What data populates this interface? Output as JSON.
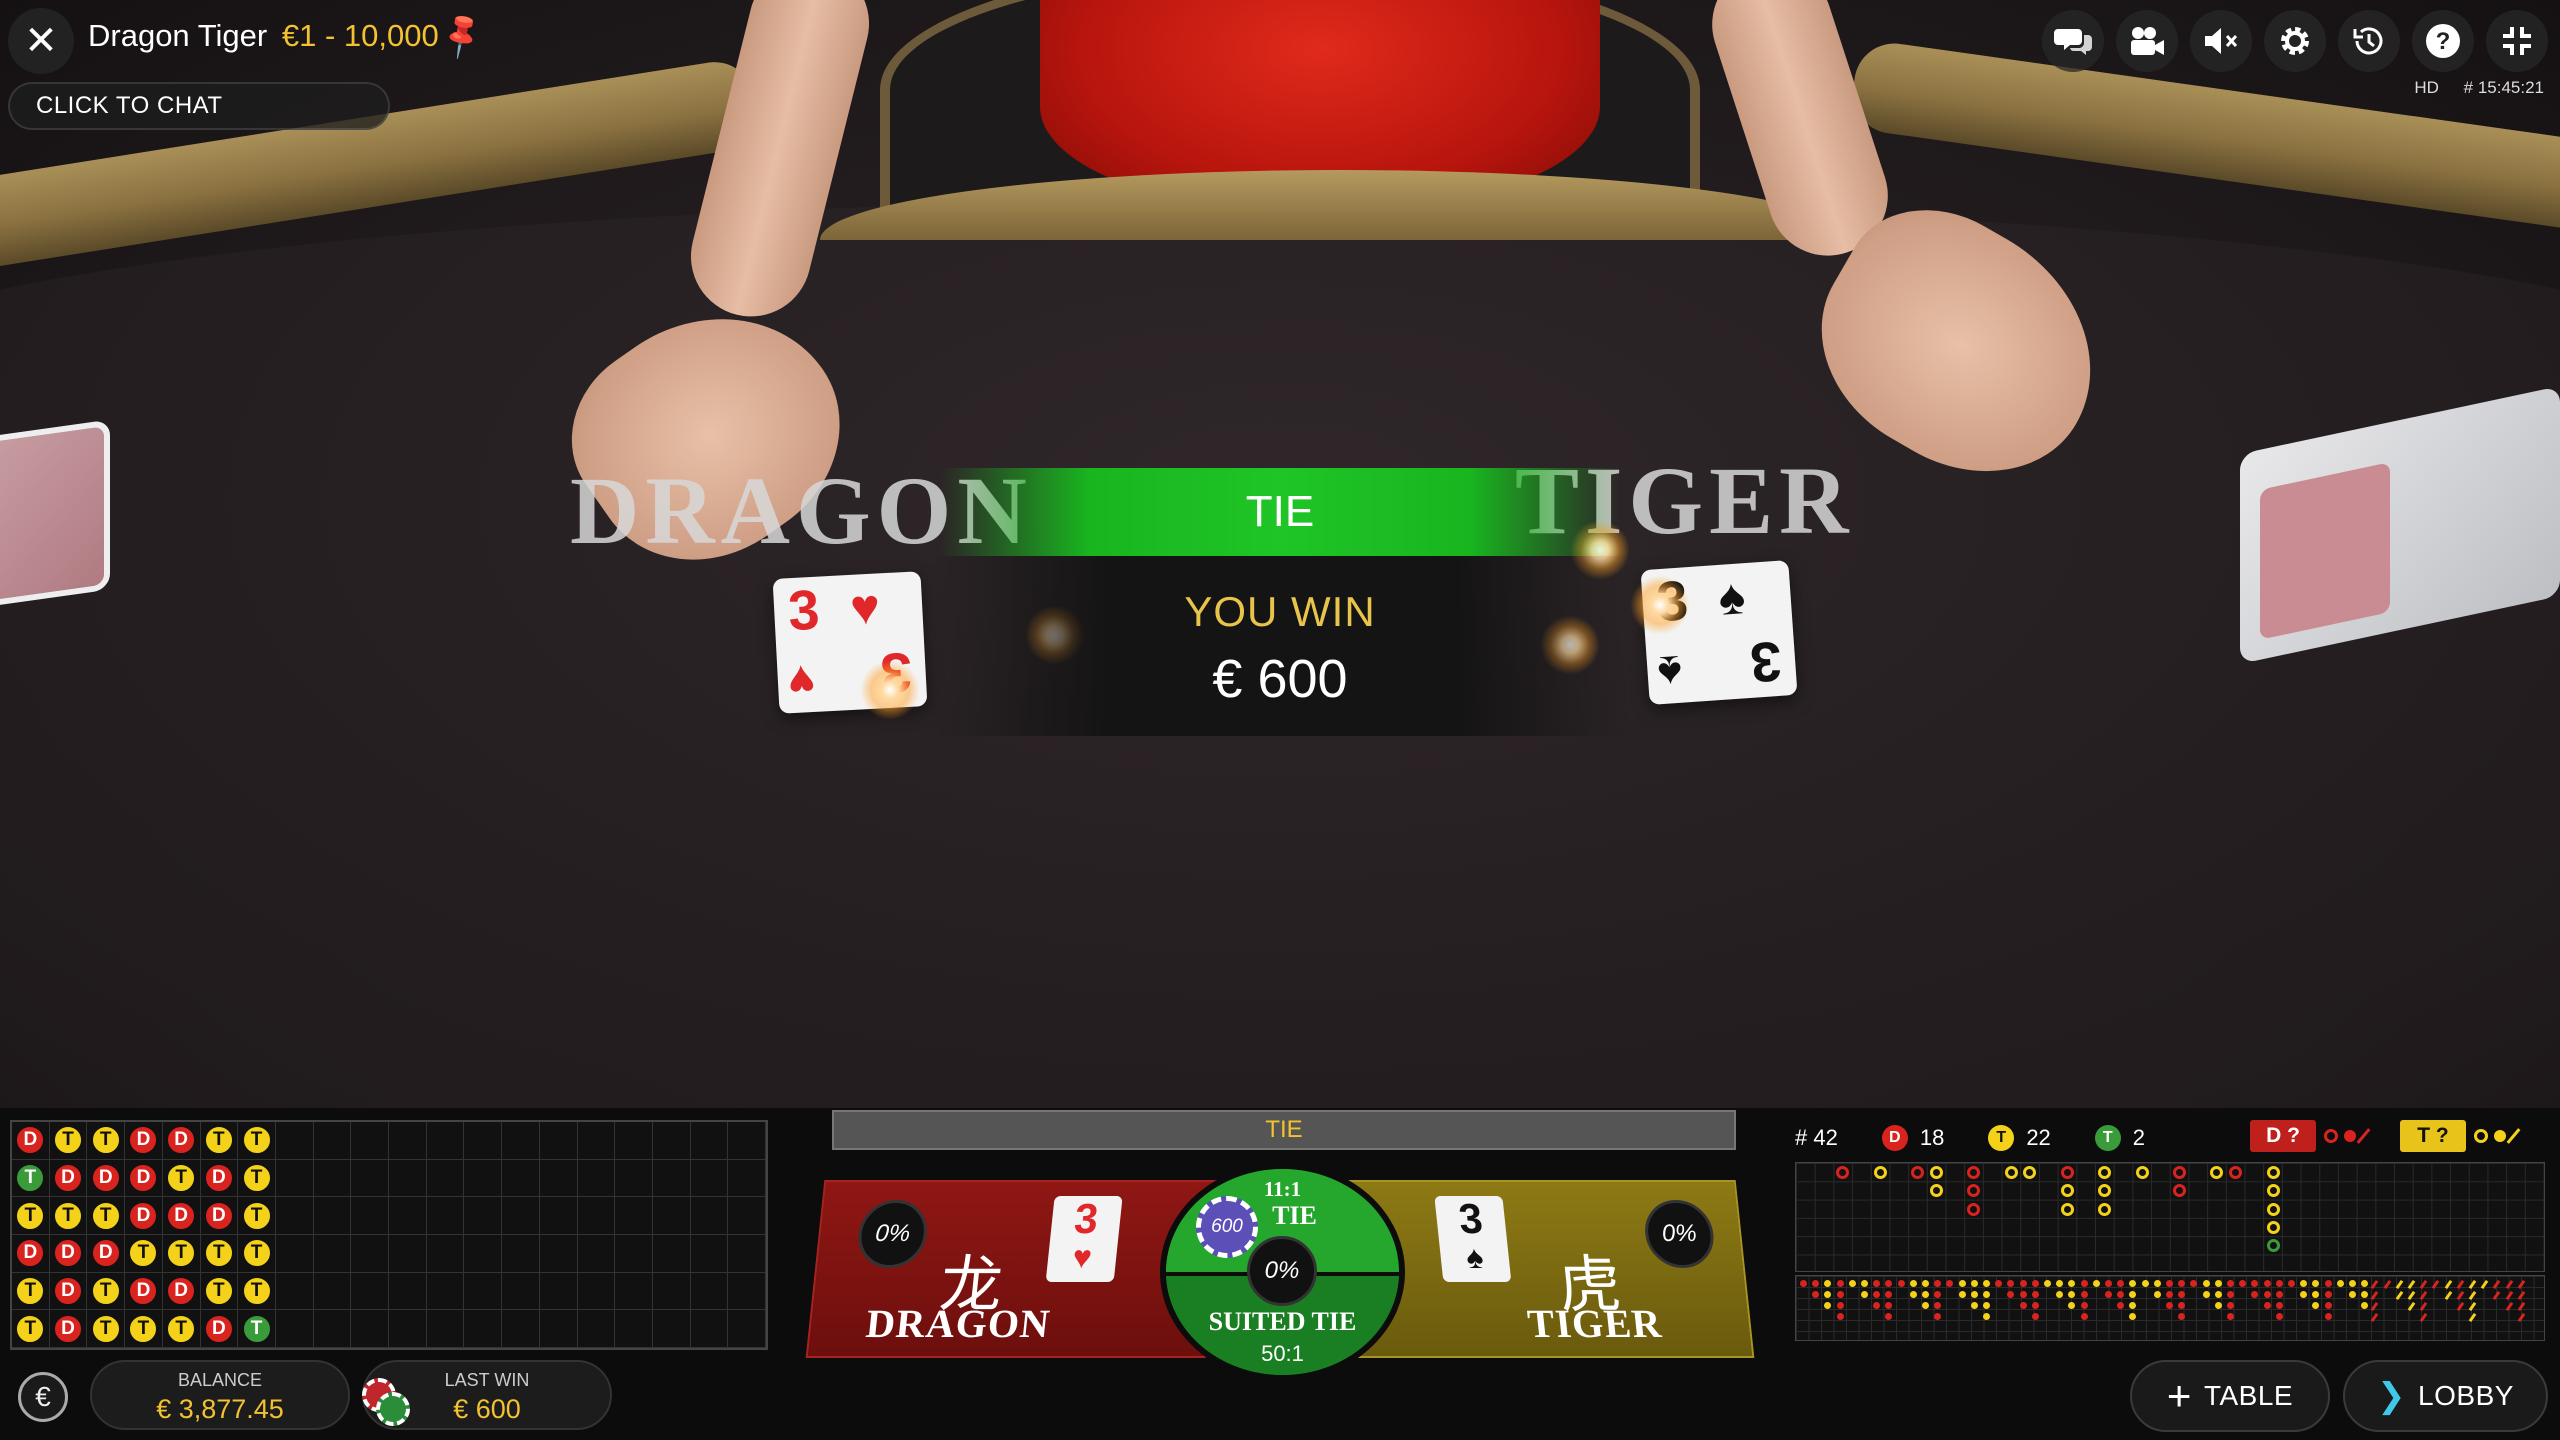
{
  "header": {
    "title": "Dragon Tiger",
    "limits": "€1 - 10,000",
    "chat_button": "CLICK TO CHAT",
    "stream_quality": "HD",
    "round_time": "# 15:45:21",
    "toolbar_icons": [
      "chat-icon",
      "video-camera-icon",
      "sound-muted-icon",
      "settings-gear-icon",
      "history-icon",
      "help-icon",
      "fullscreen-icon"
    ]
  },
  "table": {
    "dragon_word": "DRAGON",
    "tiger_word": "TIGER",
    "dragon_card": {
      "rank": "3",
      "suit": "♥"
    },
    "tiger_card": {
      "rank": "3",
      "suit": "♠"
    }
  },
  "result": {
    "outcome": "TIE",
    "win_title": "YOU WIN",
    "win_amount": "€ 600"
  },
  "bead_road": [
    [
      "D",
      "T",
      "T",
      "D",
      "D",
      "T",
      "T"
    ],
    [
      "G",
      "D",
      "D",
      "D",
      "T",
      "D",
      "T"
    ],
    [
      "T",
      "T",
      "T",
      "D",
      "D",
      "D",
      "T"
    ],
    [
      "D",
      "D",
      "D",
      "T",
      "T",
      "T",
      "T"
    ],
    [
      "T",
      "D",
      "T",
      "D",
      "D",
      "T",
      "T"
    ],
    [
      "T",
      "D",
      "T",
      "T",
      "T",
      "D",
      "G"
    ]
  ],
  "wallet": {
    "currency_symbol": "€",
    "balance_label": "BALANCE",
    "balance_value": "€ 3,877.45",
    "last_win_label": "LAST WIN",
    "last_win_value": "€ 600"
  },
  "betting": {
    "header": "TIE",
    "dragon": {
      "label": "DRAGON",
      "chinese": "龙",
      "percent": "0%",
      "card_rank": "3",
      "card_suit": "♥"
    },
    "tiger": {
      "label": "TIGER",
      "chinese": "虎",
      "percent": "0%",
      "card_rank": "3",
      "card_suit": "♠"
    },
    "tie": {
      "payout": "11:1",
      "label": "TIE",
      "chip_value": "600"
    },
    "suited_tie": {
      "label": "SUITED TIE",
      "payout": "50:1",
      "percent": "0%"
    }
  },
  "road_stats": {
    "rounds": "# 42",
    "dragon_letter": "D",
    "dragon_count": "18",
    "tiger_letter": "T",
    "tiger_count": "22",
    "tie_letter": "T",
    "tie_count": "2",
    "predict_dragon": "D ?",
    "predict_tiger": "T ?"
  },
  "colors": {
    "dragon": "#d9231f",
    "tiger": "#f5d21a",
    "tie": "#3a9b3a",
    "accent_gold": "#f2c230",
    "lobby_icon": "#3ec9e8"
  },
  "nav": {
    "table_button": "TABLE",
    "lobby_button": "LOBBY"
  }
}
